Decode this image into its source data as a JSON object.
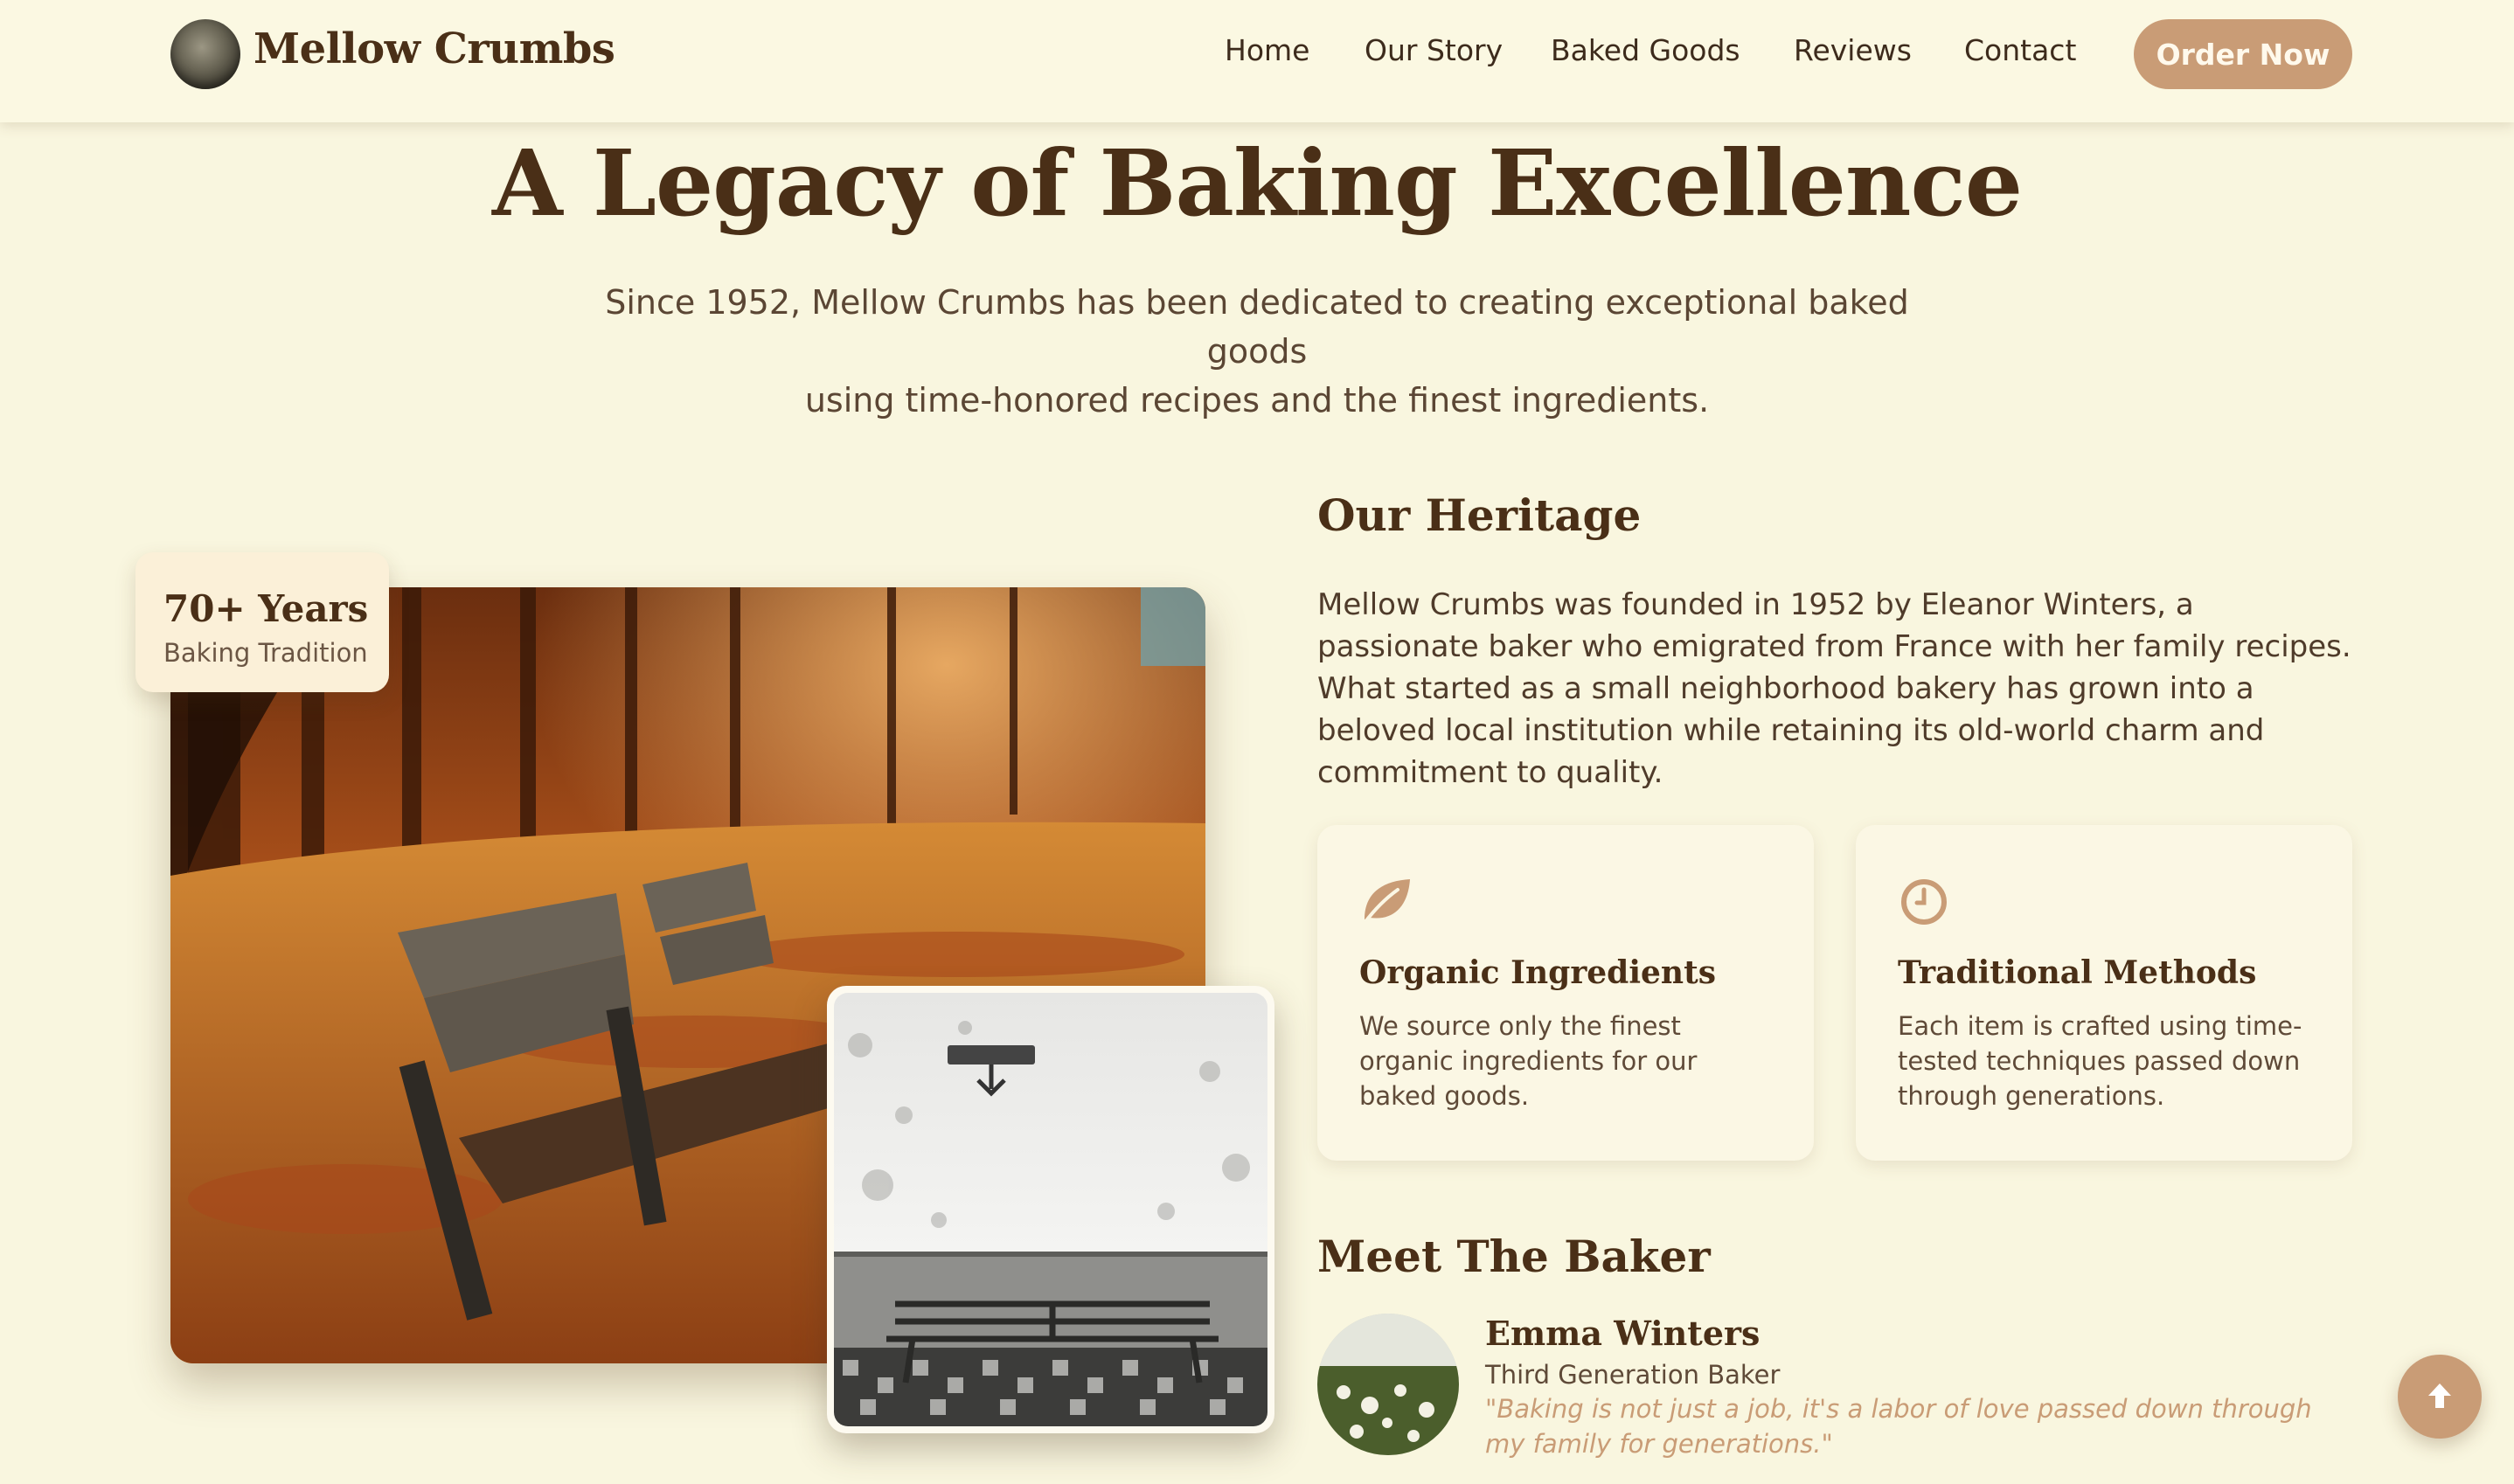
{
  "brand": {
    "name": "Mellow Crumbs",
    "accent": "#c99c76",
    "text": "#4a2f17",
    "background": "#f9f6df"
  },
  "nav": {
    "items": [
      {
        "label": "Home"
      },
      {
        "label": "Our Story"
      },
      {
        "label": "Baked Goods"
      },
      {
        "label": "Reviews"
      },
      {
        "label": "Contact"
      }
    ],
    "cta": "Order Now"
  },
  "hero": {
    "title": "A Legacy of Baking Excellence",
    "subtitle_line1": "Since 1952, Mellow Crumbs has been dedicated to creating exceptional baked goods",
    "subtitle_line2": "using time-honored recipes and the finest ingredients."
  },
  "badge": {
    "title": "70+ Years",
    "subtitle": "Baking Tradition"
  },
  "heritage": {
    "title": "Our Heritage",
    "text": "Mellow Crumbs was founded in 1952 by Eleanor Winters, a passionate baker who emigrated from France with her family recipes. What started as a small neighborhood bakery has grown into a beloved local institution while retaining its old-world charm and commitment to quality."
  },
  "features": [
    {
      "icon": "leaf-icon",
      "title": "Organic Ingredients",
      "text": "We source only the finest organic ingredients for our baked goods."
    },
    {
      "icon": "clock-icon",
      "title": "Traditional Methods",
      "text": "Each item is crafted using time-tested techniques passed down through generations."
    }
  ],
  "baker": {
    "section_title": "Meet The Baker",
    "name": "Emma Winters",
    "role": "Third Generation Baker",
    "quote": "\"Baking is not just a job, it's a labor of love passed down through my family for generations.\""
  },
  "scroll_top_icon": "arrow-up-icon"
}
